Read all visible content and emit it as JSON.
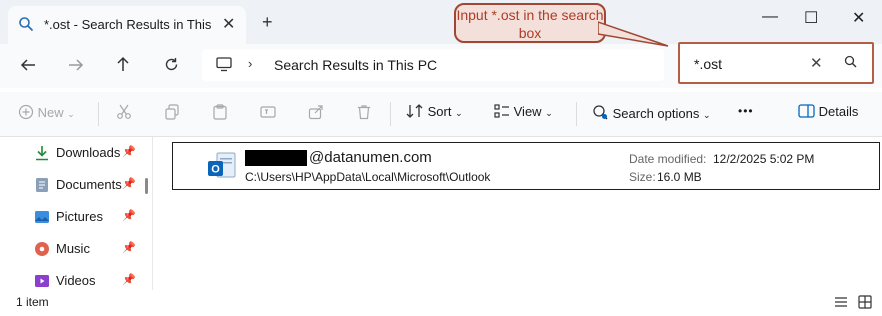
{
  "window": {
    "tab_title": "*.ost - Search Results in This P",
    "new_tab": "+",
    "tab_close": "✕",
    "minimize": "—",
    "maximize": "☐",
    "close": "✕"
  },
  "address_bar": {
    "location": "Search Results in This PC",
    "chevron": "›"
  },
  "search": {
    "value": "*.ost",
    "clear": "✕"
  },
  "callout": {
    "text": "Input *.ost in the search box",
    "border_color": "#a04632"
  },
  "toolbar": {
    "new_label": "New",
    "sort_label": "Sort",
    "view_label": "View",
    "search_options_label": "Search options",
    "more_label": "•••",
    "details_label": "Details"
  },
  "sidebar": {
    "items": [
      {
        "label": "Downloads",
        "icon": "download-icon"
      },
      {
        "label": "Documents",
        "icon": "documents-icon"
      },
      {
        "label": "Pictures",
        "icon": "pictures-icon"
      },
      {
        "label": "Music",
        "icon": "music-icon"
      },
      {
        "label": "Videos",
        "icon": "videos-icon"
      }
    ]
  },
  "result": {
    "name_suffix": "@datanumen.com",
    "path": "C:\\Users\\HP\\AppData\\Local\\Microsoft\\Outlook",
    "date_label": "Date modified:",
    "date_value": "12/2/2025 5:02 PM",
    "size_label": "Size:",
    "size_value": "16.0 MB"
  },
  "status": {
    "count": "1 item"
  },
  "colors": {
    "accent": "#0067c0",
    "highlight": "#b35e45"
  }
}
